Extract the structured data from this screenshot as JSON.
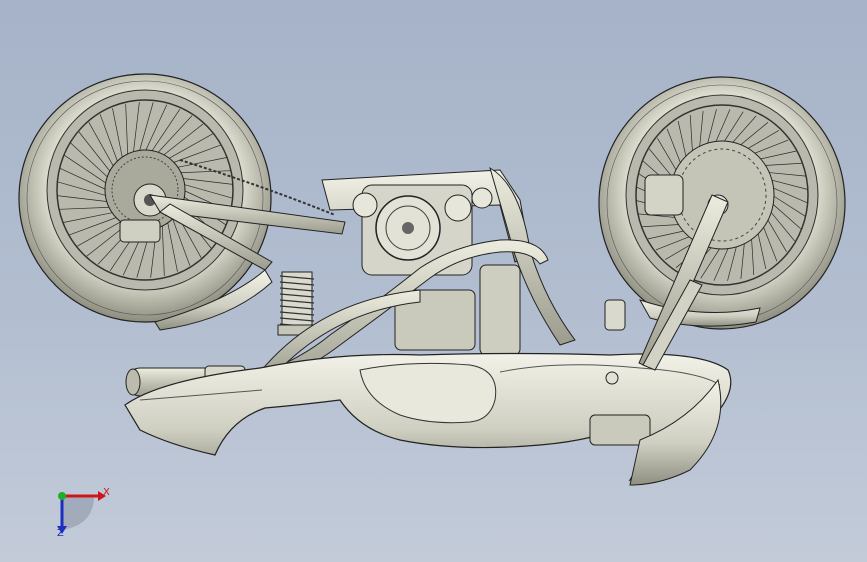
{
  "viewport": {
    "background_top": "#a6b3c8",
    "background_bottom": "#c3cbd9",
    "model": "motorcycle-assembly"
  },
  "triad": {
    "x_label": "X",
    "z_label": "Z",
    "x_color": "#d0151a",
    "y_color": "#1fae2c",
    "z_color": "#1a2fbf"
  }
}
